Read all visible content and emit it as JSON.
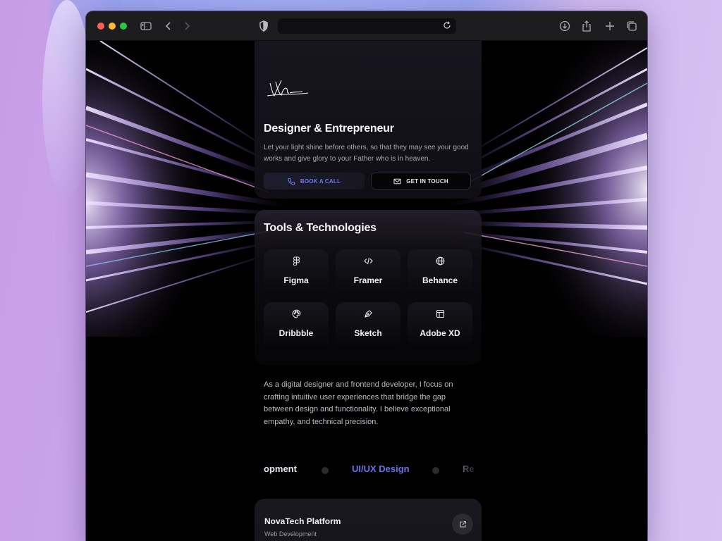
{
  "browser": {
    "url": ""
  },
  "hero": {
    "title": "Designer & Entrepreneur",
    "description": "Let your light shine before others, so that they may see your good works and give glory to your Father who is in heaven.",
    "book_call_label": "BOOK A CALL",
    "get_in_touch_label": "GET IN TOUCH"
  },
  "tools": {
    "title": "Tools & Technologies",
    "items": [
      {
        "label": "Figma",
        "icon": "figma-icon"
      },
      {
        "label": "Framer",
        "icon": "code-icon"
      },
      {
        "label": "Behance",
        "icon": "globe-icon"
      },
      {
        "label": "Dribbble",
        "icon": "palette-icon"
      },
      {
        "label": "Sketch",
        "icon": "pen-tool-icon"
      },
      {
        "label": "Adobe XD",
        "icon": "layout-icon"
      }
    ]
  },
  "about": {
    "text": "As a digital designer and frontend developer, I focus on crafting intuitive user experiences that bridge the gap between design and functionality. I believe exceptional empathy, and technical precision."
  },
  "skills_marquee": {
    "left": "opment",
    "active": "UI/UX Design",
    "right": "Re"
  },
  "project": {
    "title": "NovaTech Platform",
    "category": "Web Development"
  },
  "colors": {
    "accent": "#6c70ea",
    "page_bg": "#000000",
    "card_bg": "#16151c"
  }
}
